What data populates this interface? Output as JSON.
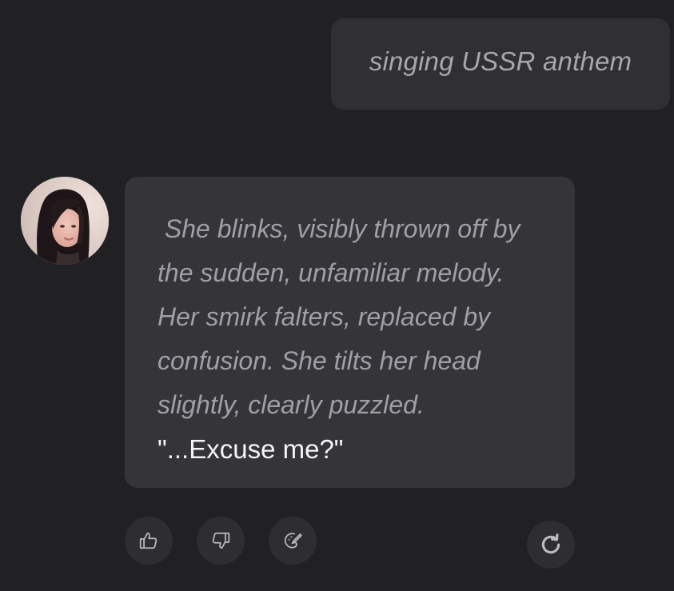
{
  "user_message": {
    "text": "singing USSR anthem"
  },
  "bot_message": {
    "narration": " She blinks, visibly thrown off by\nthe sudden, unfamiliar melody.\nHer smirk falters, replaced by\nconfusion. She tilts her head\nslightly, clearly puzzled.",
    "speech": "\"...Excuse me?\""
  },
  "actions": [
    {
      "name": "thumbs-up",
      "icon": "thumbs-up-icon"
    },
    {
      "name": "thumbs-down",
      "icon": "thumbs-down-icon"
    },
    {
      "name": "edit",
      "icon": "pen-icon"
    },
    {
      "name": "regenerate",
      "icon": "refresh-icon"
    }
  ],
  "colors": {
    "background": "#212123",
    "user_bubble": "#303034",
    "bot_bubble": "#353539",
    "narration_text": "#9f9fa6",
    "speech_text": "#f4f4f5"
  }
}
